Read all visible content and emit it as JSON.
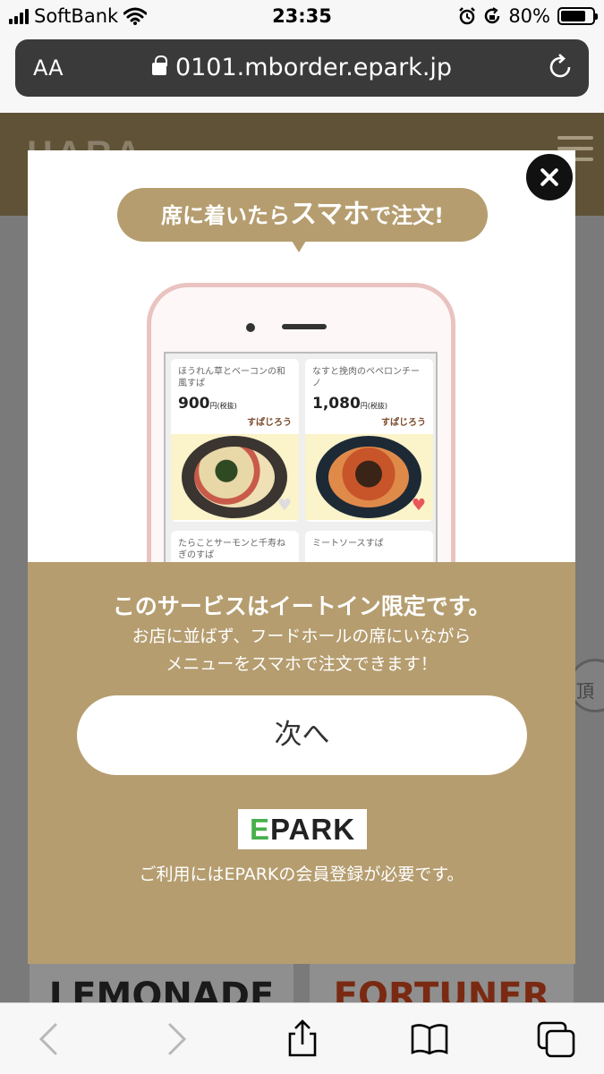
{
  "status_bar": {
    "carrier": "SoftBank",
    "time": "23:35",
    "battery_percent": "80%",
    "battery_level": 0.8,
    "icons": [
      "signal-icon",
      "wifi-icon",
      "alarm-icon",
      "orientation-lock-icon",
      "battery-icon"
    ]
  },
  "browser": {
    "text_size_label": "AA",
    "url": "0101.mborder.epark.jp",
    "icons": [
      "lock-icon",
      "reload-icon"
    ]
  },
  "background_page": {
    "logo_text": "HARA",
    "side_label": "頂",
    "shop_cards": [
      "LEMONADE",
      "FORTUNER"
    ]
  },
  "modal": {
    "bubble": {
      "prefix": "席に着いたら",
      "emphasis": "スマホ",
      "suffix": "で注文!"
    },
    "menu_items": [
      {
        "name": "ほうれん草とベーコンの和風すぱ",
        "price": "900",
        "price_note": "円(税抜)",
        "brand": "すぱじろう"
      },
      {
        "name": "なすと挽肉のペペロンチーノ",
        "price": "1,080",
        "price_note": "円(税抜)",
        "brand": "すぱじろう"
      },
      {
        "name": "たらことサーモンと千寿ねぎのすぱ",
        "price": "",
        "price_note": "",
        "brand": ""
      },
      {
        "name": "ミートソースすぱ",
        "price": "",
        "price_note": "",
        "brand": ""
      }
    ],
    "title": "このサービスはイートイン限定です。",
    "description_line1": "お店に並ばず、フードホールの席にいながら",
    "description_line2": "メニューをスマホで注文できます！",
    "next_button": "次へ",
    "epark_logo": {
      "e": "E",
      "rest": "PARK"
    },
    "note": "ご利用にはEPARKの会員登録が必要です。",
    "close_icon": "close-icon"
  },
  "toolbar": {
    "icons": [
      "back-icon",
      "forward-icon",
      "share-icon",
      "bookmarks-icon",
      "tabs-icon"
    ]
  },
  "colors": {
    "accent": "#b59d6f",
    "header_dark": "#5f5236",
    "epark_green": "#47b04b"
  }
}
